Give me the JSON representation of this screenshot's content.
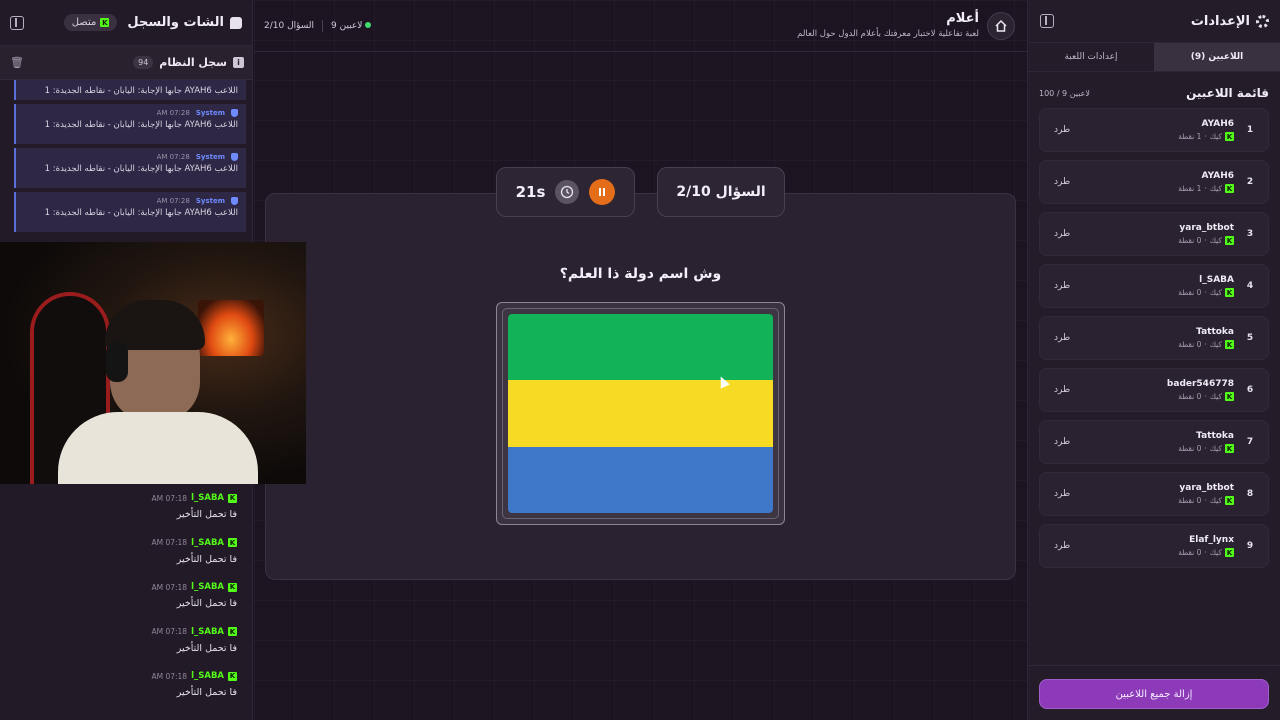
{
  "left_panel": {
    "title": "الشات والسجل",
    "status": "متصل",
    "log": {
      "title": "سجل النظام",
      "count": "94",
      "entries": [
        {
          "sender": "",
          "time": "",
          "text": "اللاعب AYAH6 جابها الإجابة: اليابان - نقاطه الجديدة: 1"
        },
        {
          "sender": "System",
          "time": "07:28 AM",
          "text": "اللاعب AYAH6 جابها الإجابة: اليابان - نقاطه الجديدة: 1"
        },
        {
          "sender": "System",
          "time": "07:28 AM",
          "text": "اللاعب AYAH6 جابها الإجابة: اليابان - نقاطه الجديدة: 1"
        },
        {
          "sender": "System",
          "time": "07:28 AM",
          "text": "اللاعب AYAH6 جابها الإجابة: اليابان - نقاطه الجديدة: 1"
        }
      ]
    },
    "chat": [
      {
        "user": "l_SABA",
        "time": "07:18 AM",
        "text": "فا تحمل التأخير"
      },
      {
        "user": "l_SABA",
        "time": "07:18 AM",
        "text": "فا تحمل التأخير"
      },
      {
        "user": "l_SABA",
        "time": "07:18 AM",
        "text": "فا تحمل التأخير"
      },
      {
        "user": "l_SABA",
        "time": "07:18 AM",
        "text": "فا تحمل التأخير"
      },
      {
        "user": "l_SABA",
        "time": "07:18 AM",
        "text": "فا تحمل التأخير"
      }
    ]
  },
  "center": {
    "game_title": "أعلام",
    "game_subtitle": "لعبة تفاعلية لاختبار معرفتك بأعلام الدول حول العالم",
    "players_count": "9 لاعبين",
    "question_progress": "السؤال 2/10",
    "question_pill": "السؤال 2/10",
    "timer": "21s",
    "question_text": "وش اسم دولة ذا العلم؟",
    "flag_colors": [
      "#12b259",
      "#f6da23",
      "#3f78c8"
    ]
  },
  "right_panel": {
    "title": "الإعدادات",
    "tabs": [
      {
        "label": "اللاعبين (9)",
        "active": true
      },
      {
        "label": "إعدادات اللعبة",
        "active": false
      }
    ],
    "list_title": "قائمة اللاعبين",
    "list_count": "100 / 9 لاعبين",
    "kick_label": "طرد",
    "players": [
      {
        "rank": "1",
        "name": "AYAH6",
        "platform": "كيك",
        "points": "1 نقطة"
      },
      {
        "rank": "2",
        "name": "AYAH6",
        "platform": "كيك",
        "points": "1 نقطة"
      },
      {
        "rank": "3",
        "name": "yara_btbot",
        "platform": "كيك",
        "points": "0 نقطة"
      },
      {
        "rank": "4",
        "name": "l_SABA",
        "platform": "كيك",
        "points": "0 نقطة"
      },
      {
        "rank": "5",
        "name": "Tattoka",
        "platform": "كيك",
        "points": "0 نقطة"
      },
      {
        "rank": "6",
        "name": "bader546778",
        "platform": "كيك",
        "points": "0 نقطة"
      },
      {
        "rank": "7",
        "name": "Tattoka",
        "platform": "كيك",
        "points": "0 نقطة"
      },
      {
        "rank": "8",
        "name": "yara_btbot",
        "platform": "كيك",
        "points": "0 نقطة"
      },
      {
        "rank": "9",
        "name": "Elaf_lynx",
        "platform": "كيك",
        "points": "0 نقطة"
      }
    ],
    "clear_button": "إزالة جميع اللاعبين"
  }
}
